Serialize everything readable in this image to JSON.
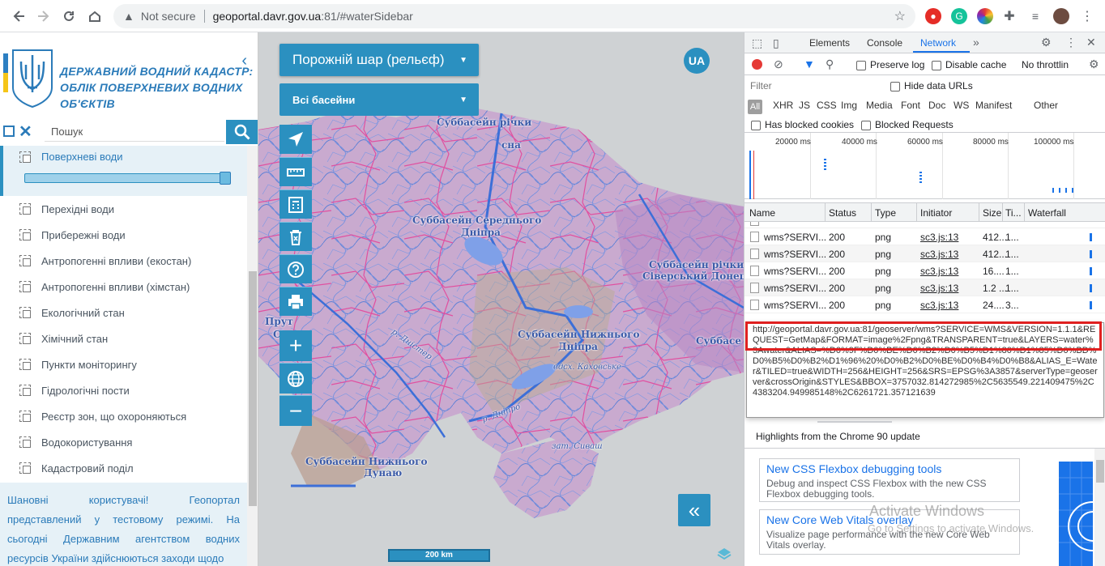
{
  "browser": {
    "back_icon": "arrow-left",
    "forward_icon": "arrow-right",
    "security_label": "Not secure",
    "url_host": "geoportal.davr.gov.ua",
    "url_rest": ":81/#waterSidebar"
  },
  "sidebar": {
    "org_title_line1": "ДЕРЖАВНИЙ ВОДНИЙ КАДАСТР:",
    "org_title_line2": "ОБЛІК ПОВЕРХНЕВИХ ВОДНИХ ОБ'ЄКТІВ",
    "search_placeholder": "Пошук",
    "active_layer": "Поверхневі води",
    "active_layer_opacity": 1.0,
    "layers": [
      "Перехідні води",
      "Прибережні води",
      "Антропогенні впливи (екостан)",
      "Антропогенні впливи (хімстан)",
      "Екологічний стан",
      "Хімічний стан",
      "Пункти моніторингу",
      "Гідрологічні пости",
      "Реєстр зон, що охороняються",
      "Водокористування",
      "Кадастровий поділ"
    ],
    "notice": "Шановні користувачі! Геопортал представлений у тестовому режимі. На сьогодні Державним агентством водних ресурсів України здійснюються заходи щодо"
  },
  "map": {
    "base_layer": "Порожній шар (рельєф)",
    "basin_filter": "Всі басейни",
    "lang": "UA",
    "scale": "200 km",
    "labels": [
      "Суббасейн річки",
      "сна",
      "Суббасейн Середнього",
      "Дніпра",
      "Суббасейн Нижнього",
      "Дніпра",
      "Суббасейн Нижнього",
      "Дунаю",
      "Суббасейн річки",
      "Сіверський Донець",
      "Суббасе",
      "вдсх. Каховське",
      "р. Дніпро",
      "р. Дністер",
      "зат. Сиваш",
      "Прут",
      "Сі"
    ],
    "tools": [
      "locate-icon",
      "ruler-icon",
      "calculator-icon",
      "delete-icon",
      "help-icon",
      "print-icon"
    ],
    "zoom_in": "+",
    "zoom_out": "−",
    "collapse": "«"
  },
  "devtools": {
    "tabs": [
      "Elements",
      "Console",
      "Network"
    ],
    "active_tab": "Network",
    "preserve_log": "Preserve log",
    "disable_cache": "Disable cache",
    "throttling": "No throttlin",
    "filter_placeholder": "Filter",
    "hide_data_urls": "Hide data URLs",
    "types": [
      "All",
      "XHR",
      "JS",
      "CSS",
      "Img",
      "Media",
      "Font",
      "Doc",
      "WS",
      "Manifest",
      "Other"
    ],
    "has_blocked_cookies": "Has blocked cookies",
    "blocked_requests": "Blocked Requests",
    "timeline_ticks": [
      "20000 ms",
      "40000 ms",
      "60000 ms",
      "80000 ms",
      "100000 ms"
    ],
    "columns": [
      "Name",
      "Status",
      "Type",
      "Initiator",
      "Size",
      "Ti...",
      "Waterfall"
    ],
    "rows": [
      {
        "name": "wms?SERVI...",
        "status": "200",
        "type": "png",
        "initiator": "sc3.js:13",
        "size": "412...",
        "time": "1..."
      },
      {
        "name": "wms?SERVI...",
        "status": "200",
        "type": "png",
        "initiator": "sc3.js:13",
        "size": "412...",
        "time": "1..."
      },
      {
        "name": "wms?SERVI...",
        "status": "200",
        "type": "png",
        "initiator": "sc3.js:13",
        "size": "16....",
        "time": "1..."
      },
      {
        "name": "wms?SERVI...",
        "status": "200",
        "type": "png",
        "initiator": "sc3.js:13",
        "size": "1.2 ...",
        "time": "1..."
      },
      {
        "name": "wms?SERVI...",
        "status": "200",
        "type": "png",
        "initiator": "sc3.js:13",
        "size": "24....",
        "time": "3..."
      }
    ],
    "tooltip_highlight": "http://geoportal.davr.gov.ua:81/geoserver/wms?SERVICE=WMS&VERSION=1.1.1&REQUEST=GetMap&FORMAT=image%2Fpng",
    "tooltip_rest": "&TRANSPARENT=true&LAYERS=water%3Awater&ALIAS=%D0%9F%D0%BE%D0%B2%D0%B5%D1%80%D1%85%D0%BD%D0%B5%D0%B2%D1%96%20%D0%B2%D0%BE%D0%B4%D0%B8&ALIAS_E=Water&TILED=true&WIDTH=256&HEIGHT=256&SRS=EPSG%3A3857&serverType=geoserver&crossOrigin&STYLES&BBOX=3757032.814272985%2C5635549.221409475%2C4383204.949985148%2C6261721.357121639",
    "highlights_title": "Highlights from the Chrome 90 update",
    "cards": [
      {
        "title": "New CSS Flexbox debugging tools",
        "desc": "Debug and inspect CSS Flexbox with the new CSS Flexbox debugging tools."
      },
      {
        "title": "New Core Web Vitals overlay",
        "desc": "Visualize page performance with the new Core Web Vitals overlay."
      }
    ]
  },
  "watermark": {
    "line1": "Activate Windows",
    "line2": "Go to Settings to activate Windows."
  },
  "colors": {
    "accent": "#2b90c0",
    "devtools_accent": "#1a73e8",
    "highlight_border": "#e02020"
  }
}
